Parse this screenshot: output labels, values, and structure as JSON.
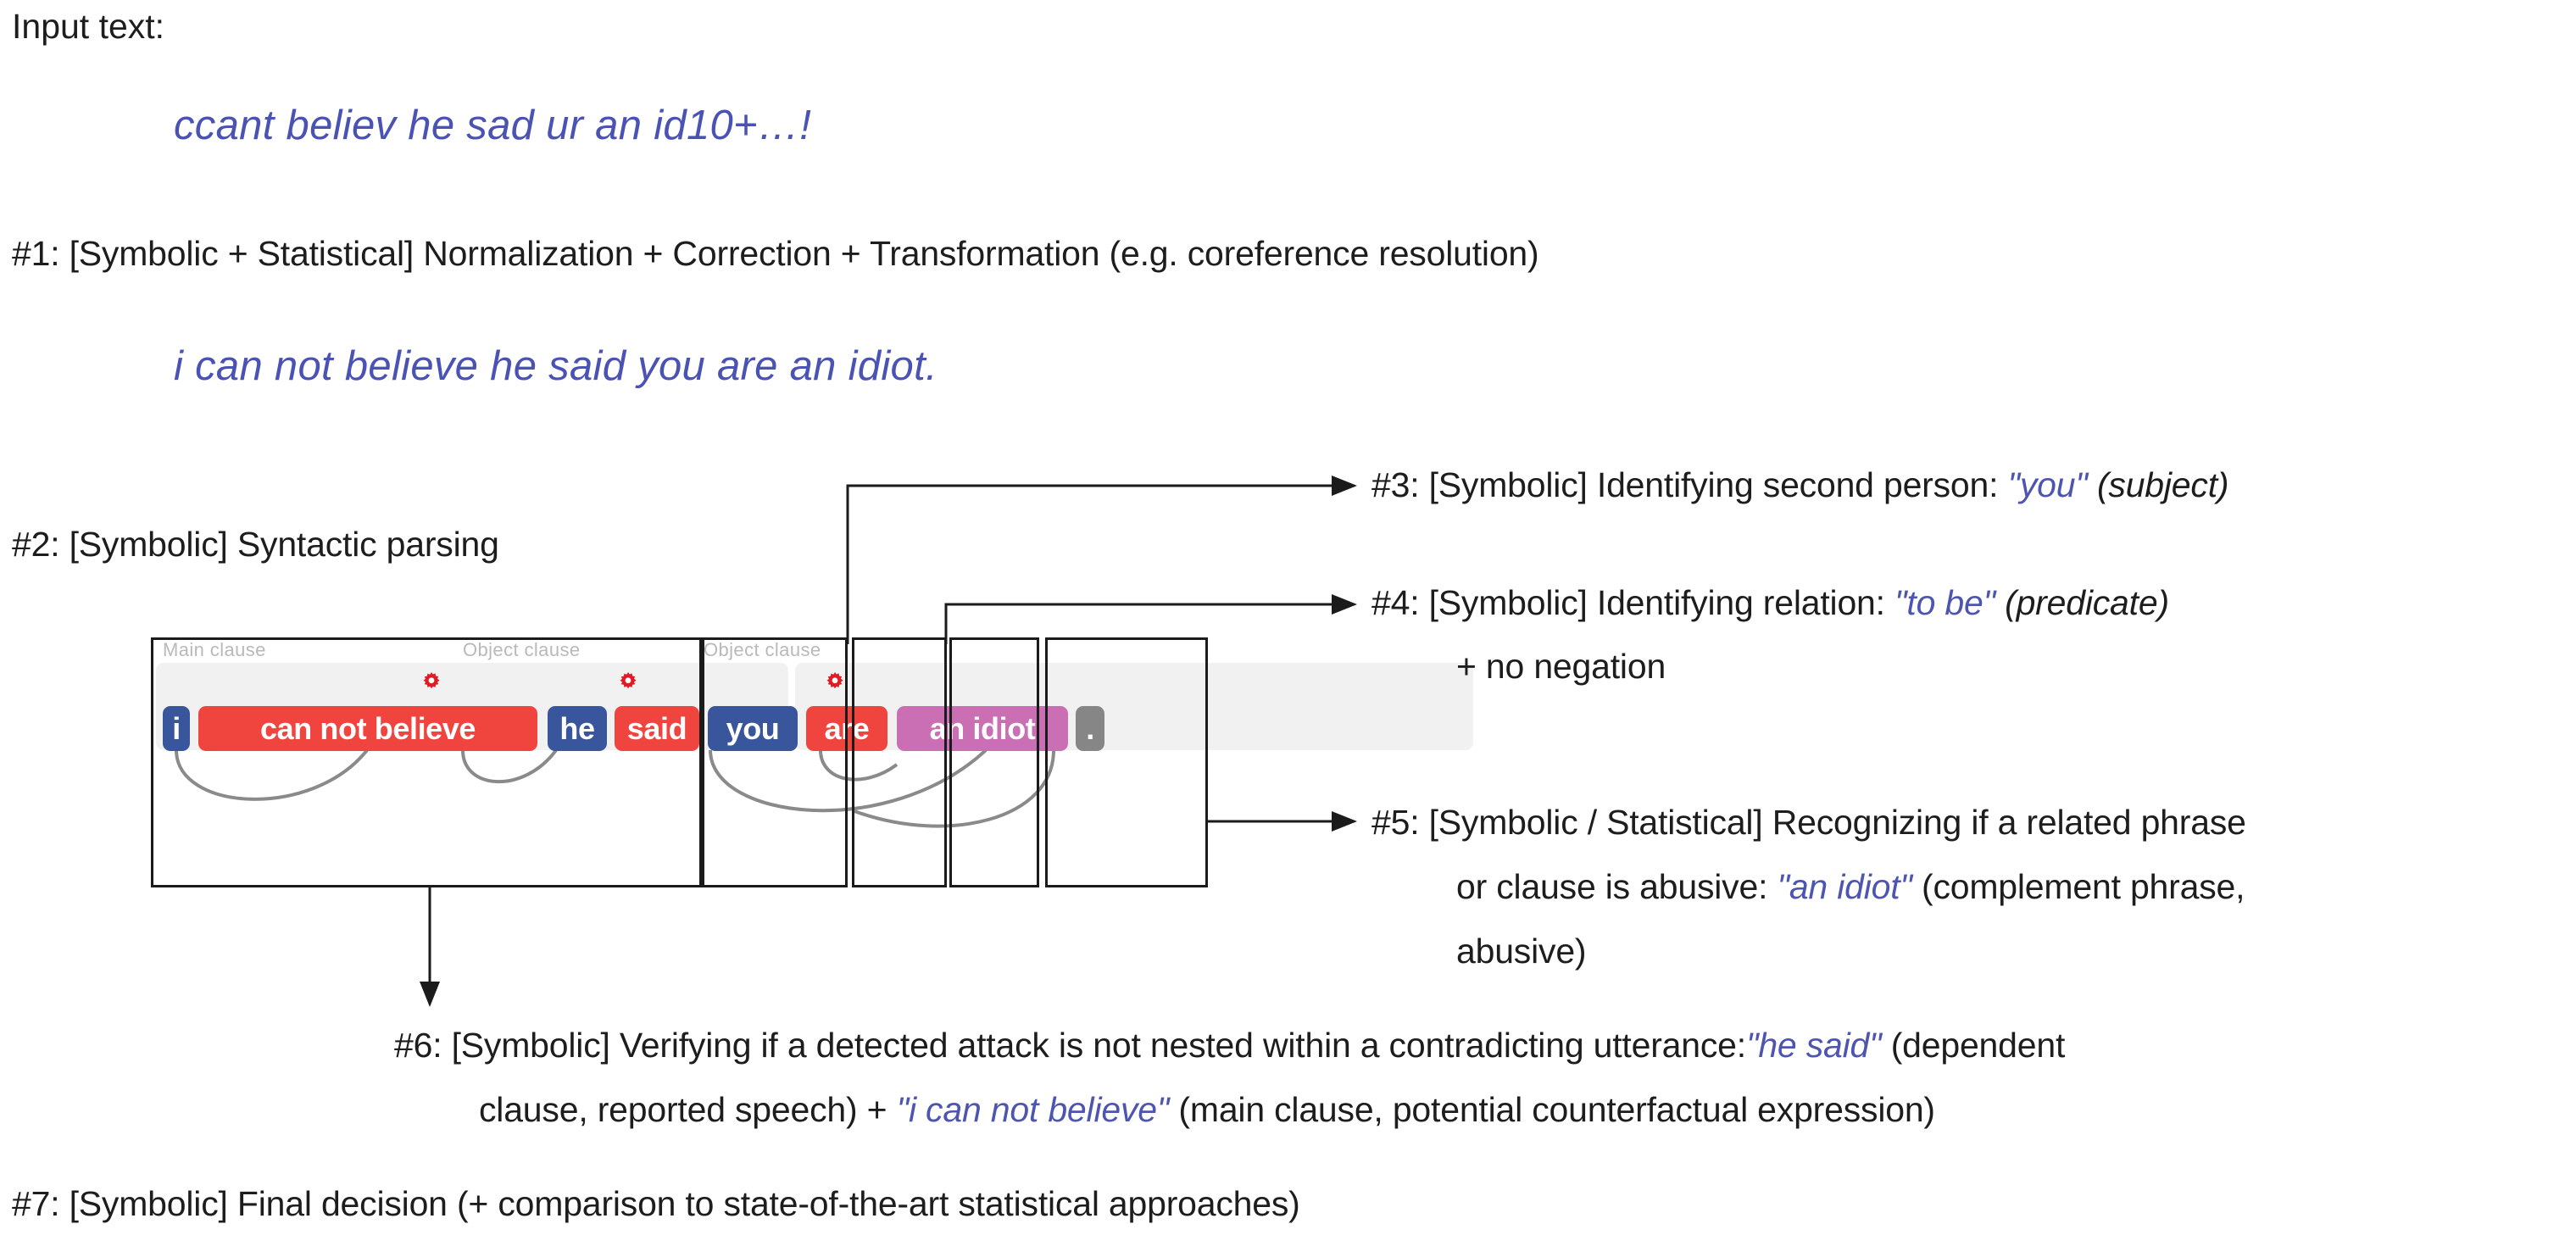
{
  "header": {
    "input_label": "Input text:",
    "input_text": "ccant believ he sad ur an id10+…!"
  },
  "steps": {
    "s1": {
      "text": "#1: [Symbolic + Statistical] Normalization + Correction + Transformation (e.g. coreference resolution)",
      "result": "i can not believe he said you are an idiot."
    },
    "s2": {
      "text": "#2: [Symbolic] Syntactic parsing"
    },
    "s3": {
      "prefix": "#3: [Symbolic] Identifying second person: ",
      "quote": "\"you\"",
      "suffix": " (subject)"
    },
    "s4": {
      "prefix": "#4: [Symbolic] Identifying relation: ",
      "quote": "\"to be\"",
      "suffix": " (predicate)",
      "line2": "+ no negation"
    },
    "s5": {
      "line1": "#5: [Symbolic / Statistical] Recognizing if a related phrase",
      "line2_prefix": "or clause is abusive: ",
      "line2_quote": "\"an idiot\"",
      "line2_suffix": " (complement phrase,",
      "line3": "abusive)"
    },
    "s6": {
      "line1_prefix": "#6: [Symbolic] Verifying if a detected attack is not nested within a contradicting utterance:",
      "line1_quote": "\"he said\"",
      "line1_suffix": " (dependent",
      "line2_prefix": "clause, reported speech) + ",
      "line2_quote": "\"i can not believe\"",
      "line2_suffix": " (main clause, potential counterfactual expression)"
    },
    "s7": {
      "text": "#7: [Symbolic] Final decision (+ comparison to state-of-the-art statistical approaches)"
    }
  },
  "diagram": {
    "clause_labels": [
      {
        "text": "Main clause"
      },
      {
        "text": "Object clause"
      },
      {
        "text": "Object clause"
      }
    ],
    "chips": [
      {
        "text": "i",
        "color": "blue"
      },
      {
        "text": "can not believe",
        "color": "red"
      },
      {
        "text": "he",
        "color": "blue"
      },
      {
        "text": "said",
        "color": "red"
      },
      {
        "text": "you",
        "color": "blue"
      },
      {
        "text": "are",
        "color": "red"
      },
      {
        "text": "an idiot",
        "color": "purple"
      },
      {
        "text": ".",
        "color": "grey"
      }
    ]
  },
  "colors": {
    "subject_blue": "#39569c",
    "predicate_red": "#f0453f",
    "complement_purple": "#ca6fb3",
    "punct_grey": "#868686",
    "quote_violet": "#4d55b0",
    "sentence_violet": "#4a53b4",
    "clause_band": "#f1f1f1",
    "clause_title": "#b9b9b9",
    "arc_grey": "#808080",
    "gear_red": "#e01b22"
  }
}
